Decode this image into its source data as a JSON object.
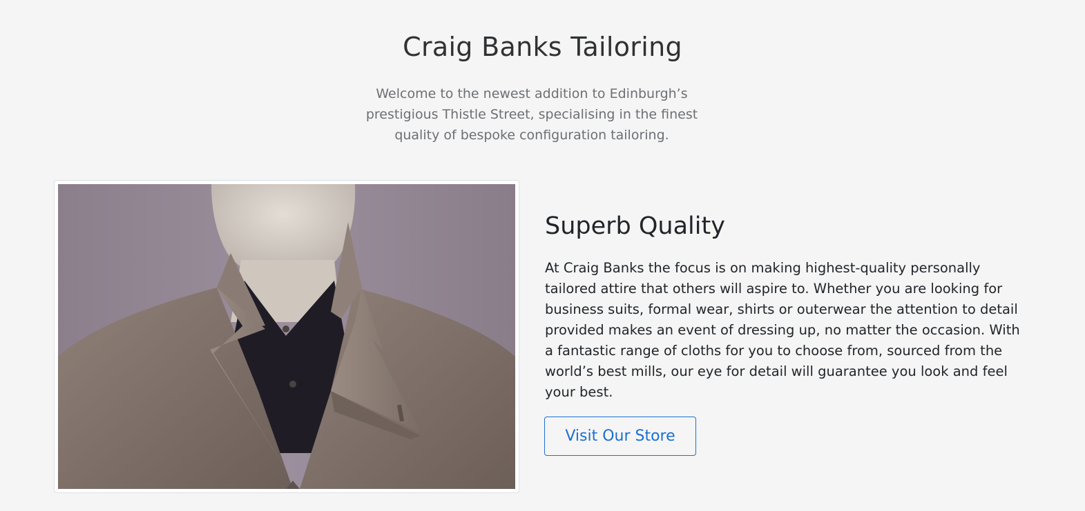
{
  "hero": {
    "title": "Craig Banks Tailoring",
    "lead": "Welcome to the newest addition to Edinburgh’s prestigious Thistle Street, specialising in the finest quality of bespoke configuration tailoring."
  },
  "feature": {
    "image_subject": "mannequin wearing a grey tailored overcoat with dark shirt",
    "title": "Superb Quality",
    "text": "At Craig Banks the focus is on making highest-quality personally tailored attire that others will aspire to. Whether you are looking for business suits, formal wear, shirts or outerwear the attention to detail provided makes an event of dressing up, no matter the occasion. With a fantastic range of cloths for you to choose from, sourced from the world’s best mills, our eye for detail will guarantee you look and feel your best.",
    "button_label": "Visit Our Store"
  },
  "colors": {
    "background": "#f5f5f5",
    "accent": "#1b6fd1",
    "heading": "#212529",
    "muted": "#6c6f73"
  }
}
